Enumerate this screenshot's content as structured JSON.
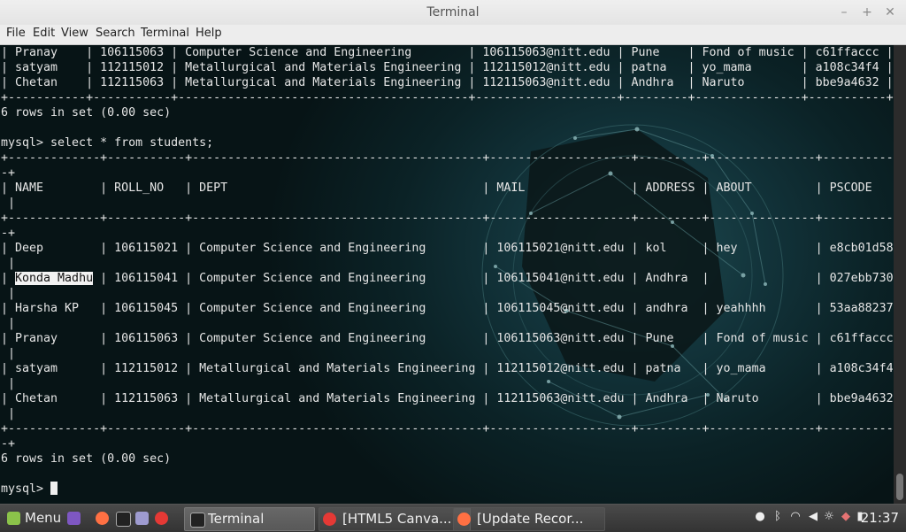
{
  "window": {
    "title": "Terminal"
  },
  "menu": {
    "items": [
      "File",
      "Edit",
      "View",
      "Search",
      "Terminal",
      "Help"
    ]
  },
  "terminal": {
    "lines": [
      "| Pranay    | 106115063 | Computer Science and Engineering        | 106115063@nitt.edu | Pune    | Fond of music | c61ffaccc |",
      "| satyam    | 112115012 | Metallurgical and Materials Engineering | 112115012@nitt.edu | patna   | yo_mama       | a108c34f4 |",
      "| Chetan    | 112115063 | Metallurgical and Materials Engineering | 112115063@nitt.edu | Andhra  | Naruto        | bbe9a4632 |",
      "+-----------+-----------+-----------------------------------------+--------------------+---------+---------------+-----------+",
      "6 rows in set (0.00 sec)",
      "",
      "mysql> select * from students;",
      "+-------------+-----------+-----------------------------------------+--------------------+---------+---------------+----------",
      "-+",
      "| NAME        | ROLL_NO   | DEPT                                    | MAIL               | ADDRESS | ABOUT         | PSCODE",
      " |",
      "+-------------+-----------+-----------------------------------------+--------------------+---------+---------------+----------",
      "-+",
      "| Deep        | 106115021 | Computer Science and Engineering        | 106115021@nitt.edu | kol     | hey           | e8cb01d58",
      " |",
      "| Konda Madhu | 106115041 | Computer Science and Engineering        | 106115041@nitt.edu | Andhra  |               | 027ebb730",
      " |",
      "| Harsha KP   | 106115045 | Computer Science and Engineering        | 106115045@nitt.edu | andhra  | yeahhhh       | 53aa88237",
      " |",
      "| Pranay      | 106115063 | Computer Science and Engineering        | 106115063@nitt.edu | Pune    | Fond of music | c61ffaccc",
      " |",
      "| satyam      | 112115012 | Metallurgical and Materials Engineering | 112115012@nitt.edu | patna   | yo_mama       | a108c34f4",
      " |",
      "| Chetan      | 112115063 | Metallurgical and Materials Engineering | 112115063@nitt.edu | Andhra  | Naruto        | bbe9a4632",
      " |",
      "+-------------+-----------+-----------------------------------------+--------------------+---------+---------------+----------",
      "-+",
      "6 rows in set (0.00 sec)",
      "",
      "mysql> "
    ],
    "selected_text": "Konda Madhu"
  },
  "taskbar": {
    "menu_label": "Menu",
    "windows": [
      {
        "label": "Terminal",
        "active": true
      },
      {
        "label": "[HTML5 Canva...",
        "active": false
      },
      {
        "label": "[Update Recor...",
        "active": false
      }
    ],
    "clock": "21:37",
    "tray_icons": [
      "user-icon",
      "bluetooth-icon",
      "wifi-icon",
      "volume-icon",
      "brightness-icon",
      "shield-icon",
      "battery-icon",
      "screen-icon"
    ]
  },
  "colors": {
    "terminal_bg": "#0b2226",
    "text": "#e6e6e6",
    "taskbar": "#3a3a3a"
  }
}
